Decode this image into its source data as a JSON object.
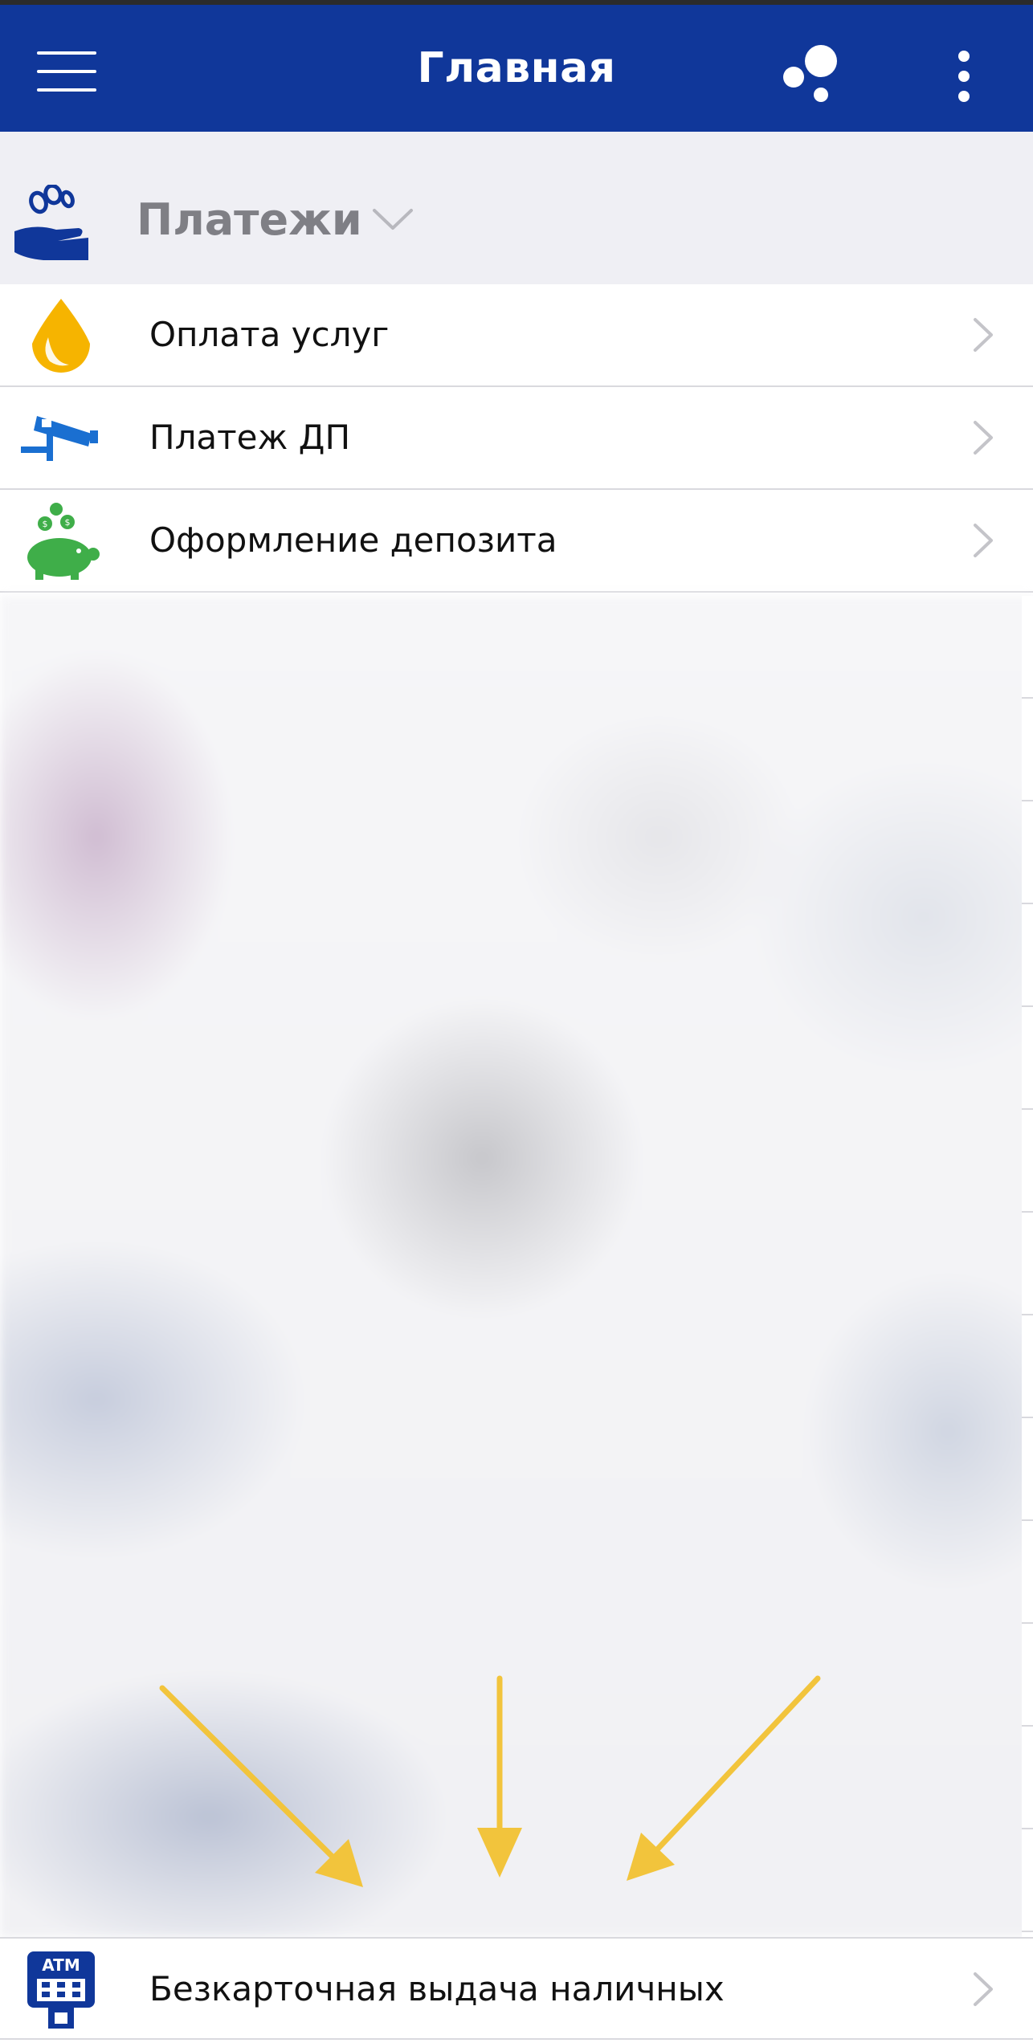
{
  "header": {
    "title": "Главная",
    "menu_icon": "hamburger-menu-icon",
    "bubbles_icon": "bubbles-icon",
    "more_icon": "vertical-dots-icon",
    "background_color": "#10379a"
  },
  "payments_section": {
    "title": "Платежи",
    "icon": "hand-with-coins-icon",
    "chevron": "chevron-down-icon"
  },
  "items": [
    {
      "label": "Оплата услуг",
      "icon": "yellow-drop-icon"
    },
    {
      "label": "Платеж ДП",
      "icon": "blue-camera-icon"
    },
    {
      "label": "Оформление депозита",
      "icon": "piggy-bank-icon"
    }
  ],
  "atm_item": {
    "label": "Безкарточная выдача наличных",
    "icon_text": "ATM",
    "icon": "atm-icon"
  },
  "annotation": {
    "arrow_color": "#f2c43c",
    "arrow_count": 3
  }
}
